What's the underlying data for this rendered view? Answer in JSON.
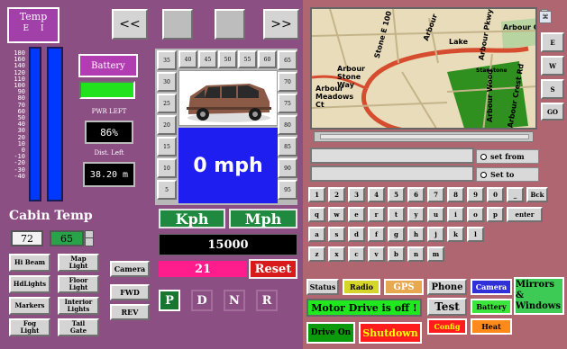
{
  "temp_widget": {
    "title": "Temp",
    "unit_e": "E",
    "unit_i": "I"
  },
  "thermo_scale": [
    "180",
    "160",
    "140",
    "120",
    "110",
    "100",
    "90",
    "80",
    "70",
    "60",
    "50",
    "40",
    "30",
    "20",
    "10",
    "0",
    "-10",
    "-20",
    "-30",
    "-40"
  ],
  "battery": {
    "label": "Battery",
    "pwr_left_label": "PWR LEFT",
    "pwr_left_value": "86%",
    "dist_left_label": "Dist. Left",
    "dist_left_value": "38.20 m",
    "level_color": "#22e11d"
  },
  "nav": {
    "prev": "<<",
    "next": ">>"
  },
  "speed_ticks_left": [
    "35",
    "30",
    "25",
    "20",
    "15",
    "10",
    "5"
  ],
  "speed_ticks_top": [
    "40",
    "45",
    "50",
    "55",
    "60"
  ],
  "speed_ticks_right": [
    "65",
    "70",
    "75",
    "80",
    "85",
    "90",
    "95"
  ],
  "speed": {
    "value": "0 mph",
    "kph": "Kph",
    "mph": "Mph"
  },
  "odometer": "15000",
  "trip": {
    "value": "21",
    "reset": "Reset"
  },
  "gears": [
    "P",
    "D",
    "N",
    "R"
  ],
  "cabin": {
    "title": "Cabin Temp",
    "current": "72",
    "setpoint": "65"
  },
  "light_buttons": [
    "Hi Beam",
    "Map\nLight",
    "HdLights",
    "Floor\nLight",
    "Markers",
    "Interior\nLights",
    "Fog\nLight",
    "Tail\nGate"
  ],
  "mode_buttons": [
    "Camera",
    "FWD",
    "REV"
  ],
  "map": {
    "labels": [
      "Arbour",
      "Stone E 100",
      "Arbour Pkwy",
      "Arbour Crest",
      "Lake",
      "Arbour Stone Way",
      "Arbour Meadows Ct",
      "Arbour Wood",
      "Arbour Crest Rd",
      "Stanstone"
    ],
    "side_buttons": [
      "E",
      "W",
      "S",
      "GO"
    ]
  },
  "route": {
    "set_from": "set from",
    "set_to": "Set to"
  },
  "keyboard": [
    [
      "1",
      "2",
      "3",
      "4",
      "5",
      "6",
      "7",
      "8",
      "9",
      "0",
      "_",
      "Bck"
    ],
    [
      "q",
      "w",
      "e",
      "r",
      "t",
      "y",
      "u",
      "i",
      "o",
      "p",
      "enter"
    ],
    [
      "a",
      "s",
      "d",
      "f",
      "g",
      "h",
      "j",
      "k",
      "l"
    ],
    [
      "z",
      "x",
      "c",
      "v",
      "b",
      "n",
      "m"
    ]
  ],
  "bottom": {
    "status": "Status",
    "radio": "Radio",
    "gps": "GPS",
    "phone": "Phone",
    "camera": "Camera",
    "mirrors": "Mirrors &\nWindows",
    "motor_drive": "Motor Drive is off !",
    "test": "Test",
    "battery": "Battery",
    "drive_on": "Drive On",
    "shutdown": "Shutdown",
    "config": "Config",
    "heat": "Heat"
  },
  "colors": {
    "speed_panel": "#1e1ef0",
    "odometer_bg": "#000000",
    "trip_bg": "#ff1c8c",
    "reset_bg": "#d81a1a"
  }
}
